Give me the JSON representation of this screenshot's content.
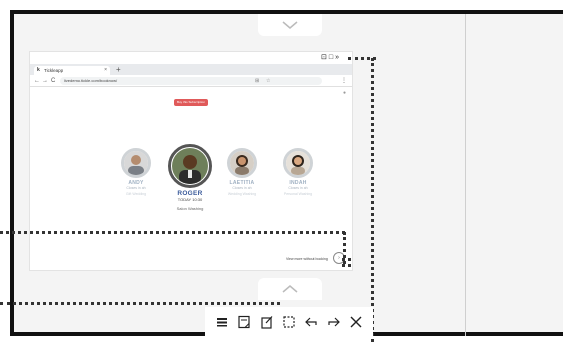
{
  "icons": {
    "top_tab": "chevron-down-icon",
    "bottom_tab": "chevron-up-icon",
    "corner": [
      "camera-icon",
      "square-icon",
      "double-chevron-right-icon"
    ],
    "toolbar": [
      "menu-icon",
      "note-icon",
      "edit-note-icon",
      "select-rect-icon",
      "undo-icon",
      "redo-icon",
      "close-icon"
    ]
  },
  "browser": {
    "favicon": "k",
    "tab_title": "Tickleapp",
    "tab_close": "×",
    "new_tab": "+",
    "back": "←",
    "forward": "→",
    "reload": "C",
    "url": "livedemo.tickle.com/booknow/",
    "menu": "⋮"
  },
  "page": {
    "book_button": "Buy this Subscription",
    "people": [
      {
        "name": "ANDY",
        "sub": "Closes in ah",
        "role": "Gift Wedding",
        "active": false
      },
      {
        "name": "ROGER",
        "sub": "TODAY 10:30",
        "role": "Salon Washing",
        "active": true
      },
      {
        "name": "LAETITIA",
        "sub": "Closes in ah",
        "role": "Wedding Washing",
        "active": false
      },
      {
        "name": "INDAH",
        "sub": "Closes in ah",
        "role": "Personal Washing",
        "active": false
      }
    ],
    "view_link": "View more without booking",
    "view_arrow": "›"
  },
  "colors": {
    "frame": "#111111",
    "accent_button": "#e05a5a",
    "active_name": "#3a5a9a",
    "inactive_name": "#9fb0c2"
  }
}
